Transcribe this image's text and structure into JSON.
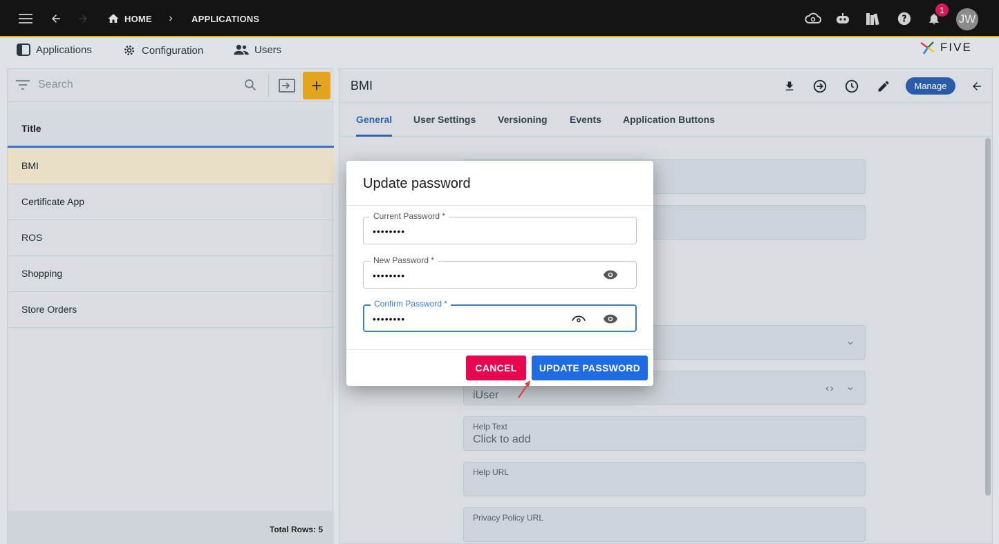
{
  "topbar": {
    "breadcrumb_home": "HOME",
    "breadcrumb_current": "APPLICATIONS",
    "notification_count": "1",
    "avatar_initials": "JW"
  },
  "menu": {
    "applications": "Applications",
    "configuration": "Configuration",
    "users": "Users",
    "logo_text": "FIVE"
  },
  "left_panel": {
    "search_placeholder": "Search",
    "add_symbol": "+",
    "column_title": "Title",
    "rows": [
      "BMI",
      "Certificate App",
      "ROS",
      "Shopping",
      "Store Orders"
    ],
    "selected_row": "BMI",
    "total_rows": "Total Rows: 5"
  },
  "right_panel": {
    "title": "BMI",
    "manage_label": "Manage",
    "tabs": [
      "General",
      "User Settings",
      "Versioning",
      "Events",
      "Application Buttons"
    ],
    "active_tab": "General",
    "fields": {
      "user_value": "iUser",
      "help_text_label": "Help Text",
      "help_text_value": "Click to add",
      "help_url_label": "Help URL",
      "privacy_label": "Privacy Policy URL"
    }
  },
  "dialog": {
    "title": "Update password",
    "current_label": "Current Password *",
    "current_value": "••••••••",
    "new_label": "New Password *",
    "new_value": "••••••••",
    "confirm_label": "Confirm Password *",
    "confirm_value": "••••••••",
    "cancel_label": "CANCEL",
    "update_label": "UPDATE PASSWORD"
  },
  "colors": {
    "accent": "#e3a51e",
    "primary": "#1f6be3",
    "danger": "#e8074f",
    "tab_active": "#2f64b3"
  },
  "icons": [
    "menu-icon",
    "back-arrow-icon",
    "forward-arrow-icon",
    "home-icon",
    "chevron-right-icon",
    "cloud-settings-icon",
    "robot-icon",
    "books-icon",
    "help-icon",
    "bell-icon",
    "filter-icon",
    "search-icon",
    "collapse-panel-icon",
    "download-icon",
    "login-arrow-icon",
    "history-icon",
    "pencil-icon",
    "eye-icon"
  ]
}
